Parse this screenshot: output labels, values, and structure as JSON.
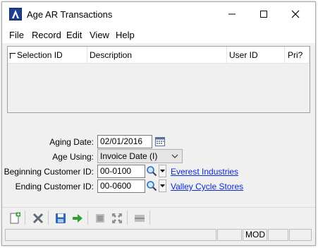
{
  "window": {
    "title": "Age AR Transactions"
  },
  "menu": [
    "File",
    "Record",
    "Edit",
    "View",
    "Help"
  ],
  "grid": {
    "columns": [
      "Selection ID",
      "Description",
      "User ID",
      "Pri?"
    ],
    "rows": []
  },
  "form": {
    "aging_date_label": "Aging Date:",
    "aging_date_value": "02/01/2016",
    "age_using_label": "Age Using:",
    "age_using_value": "Invoice Date (I)",
    "begin_customer_label": "Beginning Customer ID:",
    "begin_customer_value": "00-0100",
    "begin_customer_name": "Everest Industries",
    "end_customer_label": "Ending Customer ID:",
    "end_customer_value": "00-0600",
    "end_customer_name": "Valley Cycle Stores"
  },
  "toolbar": {
    "icons": [
      "new-icon",
      "delete-icon",
      "save-icon",
      "process-icon",
      "cut-icon",
      "expand-icon",
      "collapse-icon"
    ]
  },
  "status": {
    "cells": [
      "",
      "",
      "MOD",
      "",
      ""
    ]
  },
  "colors": {
    "link": "#0b2bd6",
    "logo": "#1f3f8f",
    "process_green": "#2e9e2e"
  }
}
